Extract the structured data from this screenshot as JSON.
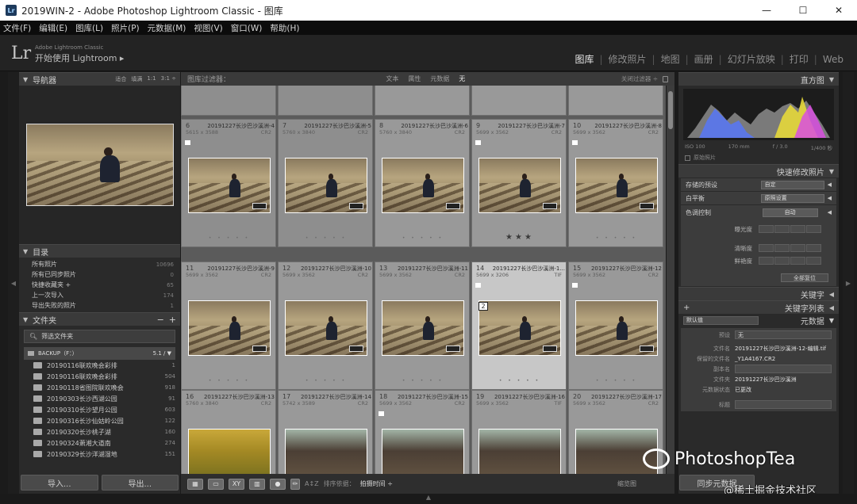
{
  "window": {
    "title": "2019WIN-2 - Adobe Photoshop Lightroom Classic - 图库",
    "app_icon": "Lr"
  },
  "menu": [
    "文件(F)",
    "编辑(E)",
    "图库(L)",
    "照片(P)",
    "元数据(M)",
    "视图(V)",
    "窗口(W)",
    "帮助(H)"
  ],
  "identity": {
    "logo": "Lr",
    "line1": "Adobe Lightroom Classic",
    "line2": "开始使用 Lightroom ▸"
  },
  "modules": [
    "图库",
    "修改照片",
    "地图",
    "画册",
    "幻灯片放映",
    "打印",
    "Web"
  ],
  "navigator": {
    "title": "导航器",
    "options": [
      "适合",
      "填满",
      "1:1",
      "3:1 ÷"
    ]
  },
  "catalog": {
    "title": "目录",
    "items": [
      {
        "label": "所有照片",
        "count": "10696"
      },
      {
        "label": "所有已同步照片",
        "count": "0"
      },
      {
        "label": "快捷收藏夹 +",
        "count": "65"
      },
      {
        "label": "上一次导入",
        "count": "174"
      },
      {
        "label": "导出失败的照片",
        "count": "1"
      }
    ]
  },
  "folders": {
    "title": "文件夹",
    "search_label": "筛选文件夹",
    "volume": "BACKUP（F：）",
    "volume_info": "5.1 / ▼",
    "items": [
      {
        "label": "20190116联欢晚会彩排",
        "count": "1"
      },
      {
        "label": "20190116联欢晚会彩排",
        "count": "504"
      },
      {
        "label": "20190118省图院联欢晚会",
        "count": "918"
      },
      {
        "label": "20190303长沙西湖公园",
        "count": "91"
      },
      {
        "label": "20190310长沙望月公园",
        "count": "603"
      },
      {
        "label": "20190316长沙仙姑岭公园",
        "count": "122"
      },
      {
        "label": "20190320长沙桃子湖",
        "count": "160"
      },
      {
        "label": "20190324萧湘大道南",
        "count": "274"
      },
      {
        "label": "20190329长沙洋湖湿地",
        "count": "151"
      }
    ]
  },
  "left_buttons": {
    "import": "导入...",
    "export": "导出..."
  },
  "filter_bar": {
    "label": "图库过滤器：",
    "options": [
      "文本",
      "属性",
      "元数据",
      "无"
    ],
    "close": "关闭过滤器 ÷"
  },
  "grid": {
    "rows": [
      [
        {
          "num": "6",
          "name": "20191227长沙巴沙溪洲-4",
          "dim": "5615 x 3588",
          "ext": "CR2",
          "flag": true,
          "stars": "",
          "selected": false
        },
        {
          "num": "7",
          "name": "20191227长沙巴沙溪洲-5",
          "dim": "5760 x 3840",
          "ext": "CR2",
          "flag": false,
          "stars": "",
          "selected": false
        },
        {
          "num": "8",
          "name": "20191227长沙巴沙溪洲-6",
          "dim": "5760 x 3840",
          "ext": "CR2",
          "flag": false,
          "stars": "",
          "selected": false
        },
        {
          "num": "9",
          "name": "20191227长沙巴沙溪洲-7",
          "dim": "5699 x 3562",
          "ext": "CR2",
          "flag": true,
          "stars": "★★★",
          "selected": false
        },
        {
          "num": "10",
          "name": "20191227长沙巴沙溪洲-8",
          "dim": "5699 x 3562",
          "ext": "CR2",
          "flag": true,
          "stars": "",
          "selected": false
        }
      ],
      [
        {
          "num": "11",
          "name": "20191227长沙巴沙溪洲-9",
          "dim": "5699 x 3562",
          "ext": "CR2",
          "flag": false,
          "stars": "",
          "selected": false
        },
        {
          "num": "12",
          "name": "20191227长沙巴沙溪洲-10",
          "dim": "5699 x 3562",
          "ext": "CR2",
          "flag": false,
          "stars": "",
          "selected": false
        },
        {
          "num": "13",
          "name": "20191227长沙巴沙溪洲-11",
          "dim": "5699 x 3562",
          "ext": "CR2",
          "flag": false,
          "stars": "",
          "selected": false
        },
        {
          "num": "14",
          "name": "20191227长沙巴沙溪洲-1...",
          "dim": "5699 x 3206",
          "ext": "TIF",
          "flag": true,
          "stars": "",
          "selected": true,
          "stack": "2"
        },
        {
          "num": "15",
          "name": "20191227长沙巴沙溪洲-12",
          "dim": "5699 x 3562",
          "ext": "CR2",
          "flag": true,
          "stars": "",
          "selected": false
        }
      ],
      [
        {
          "num": "16",
          "name": "20191227长沙巴沙溪洲-13",
          "dim": "5760 x 3840",
          "ext": "CR2",
          "flag": false,
          "stars": "",
          "selected": false
        },
        {
          "num": "17",
          "name": "20191227长沙巴沙溪洲-14",
          "dim": "5742 x 3589",
          "ext": "CR2",
          "flag": false,
          "stars": "",
          "selected": false
        },
        {
          "num": "18",
          "name": "20191227长沙巴沙溪洲-15",
          "dim": "5699 x 3562",
          "ext": "CR2",
          "flag": true,
          "stars": "",
          "selected": false
        },
        {
          "num": "19",
          "name": "20191227长沙巴沙溪洲-16",
          "dim": "5699 x 3562",
          "ext": "TIF",
          "flag": false,
          "stars": "",
          "selected": false
        },
        {
          "num": "20",
          "name": "20191227长沙巴沙溪洲-17",
          "dim": "5699 x 3562",
          "ext": "CR2",
          "flag": false,
          "stars": "",
          "selected": false
        }
      ]
    ]
  },
  "toolbar": {
    "sort_label": "排序依据：",
    "sort_value": "拍摄时间 ÷",
    "thumbs": "缩览图"
  },
  "histogram": {
    "title": "直方图",
    "iso": "ISO 100",
    "focal": "170 mm",
    "aperture": "f / 3.0",
    "shutter": "1/400 秒",
    "original": "原始照片"
  },
  "quick_develop": {
    "title": "快速修改照片",
    "saved_preset_label": "存储的预设",
    "saved_preset_value": "自定",
    "wb_label": "白平衡",
    "wb_value": "原照设置",
    "tone_label": "色调控制",
    "auto": "自动",
    "exposure": "曝光度",
    "clarity": "清晰度",
    "vibrance": "鲜艳度",
    "reset": "全部复位"
  },
  "keywording": {
    "title": "关键字"
  },
  "keyword_list": {
    "title": "关键字列表",
    "add": "+"
  },
  "metadata": {
    "title": "元数据",
    "default": "默认值",
    "preset_label": "预设",
    "preset_value": "无",
    "filename_label": "文件名",
    "filename_value": "20191227长沙巴沙溪洲-12-编辑.tif",
    "copy_label": "保留的文件名",
    "copy_value": "_Y1A4167.CR2",
    "copyname_label": "副本名",
    "folder_label": "文件夹",
    "folder_value": "20191227长沙巴沙溪洲",
    "status_label": "元数据状态",
    "status_value": "已更改",
    "title_label": "标题"
  },
  "sync_button": "同步元数据",
  "watermark": {
    "text": "PhotoshopTea",
    "text2": "@稀土掘金技术社区"
  },
  "colors": {
    "accent": "#e8e8e8",
    "grid_bg": "#5b5b5b",
    "selected_cell": "#c7c7c7"
  }
}
